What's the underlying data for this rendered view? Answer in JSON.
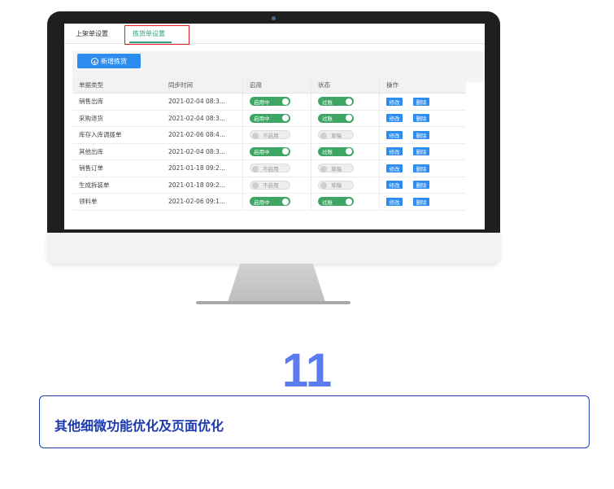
{
  "tabs": [
    "上架单设置",
    "拣货单设置"
  ],
  "add_button_label": "新增拣货",
  "columns": [
    "单据类型",
    "同步时间",
    "启用",
    "状态",
    "操作"
  ],
  "rows": [
    {
      "type": "销售出库",
      "time": "2021-02-04 08:3...",
      "enabled": "启用中",
      "state": "过账",
      "on": true
    },
    {
      "type": "采购退货",
      "time": "2021-02-04 08:3...",
      "enabled": "启用中",
      "state": "过账",
      "on": true
    },
    {
      "type": "库存入库调拨单",
      "time": "2021-02-06 08:4...",
      "enabled": "不启用",
      "state": "草稿",
      "on": false
    },
    {
      "type": "其他出库",
      "time": "2021-02-04 08:3...",
      "enabled": "启用中",
      "state": "过账",
      "on": true
    },
    {
      "type": "销售订单",
      "time": "2021-01-18 09:2...",
      "enabled": "不启用",
      "state": "草稿",
      "on": false
    },
    {
      "type": "生成拆装单",
      "time": "2021-01-18 09:2...",
      "enabled": "不启用",
      "state": "草稿",
      "on": false
    },
    {
      "type": "领料单",
      "time": "2021-02-06 09:1...",
      "enabled": "启用中",
      "state": "过账",
      "on": true
    }
  ],
  "actions": {
    "edit": "修改",
    "delete": "删除"
  },
  "section_number": "11",
  "caption": "其他细微功能优化及页面优化",
  "colors": {
    "accent_blue": "#2d8cf0",
    "toggle_green": "#3fa565",
    "tab_green": "#2f9f7e",
    "highlight_red": "#e02020",
    "number_blue": "#5b7cf0",
    "caption_blue": "#1c39b0"
  }
}
